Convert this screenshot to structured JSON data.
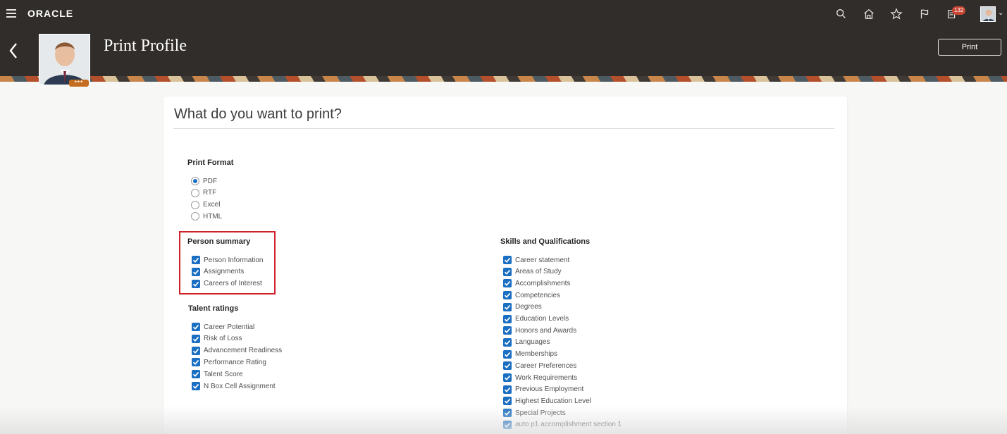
{
  "app": {
    "logo": "ORACLE",
    "notification_count": "132"
  },
  "header": {
    "title": "Print Profile",
    "print_label": "Print",
    "photo_more": "•••"
  },
  "card": {
    "title": "What do you want to print?"
  },
  "print_format": {
    "label": "Print Format",
    "selected": "PDF",
    "options": [
      "PDF",
      "RTF",
      "Excel",
      "HTML"
    ]
  },
  "person_summary": {
    "label": "Person summary",
    "items": [
      "Person Information",
      "Assignments",
      "Careers of Interest"
    ]
  },
  "talent_ratings": {
    "label": "Talent ratings",
    "items": [
      "Career Potential",
      "Risk of Loss",
      "Advancement Readiness",
      "Performance Rating",
      "Talent Score",
      "N Box Cell Assignment"
    ]
  },
  "skills": {
    "label": "Skills and Qualifications",
    "items": [
      "Career statement",
      "Areas of Study",
      "Accomplishments",
      "Competencies",
      "Degrees",
      "Education Levels",
      "Honors and Awards",
      "Languages",
      "Memberships",
      "Career Preferences",
      "Work Requirements",
      "Previous Employment",
      "Highest Education Level",
      "Special Projects",
      "auto p1 accomplishment section 1"
    ]
  },
  "colors": {
    "topbar": "#312d2a",
    "checkbox": "#1a6fc2",
    "highlight": "#d0202a"
  }
}
